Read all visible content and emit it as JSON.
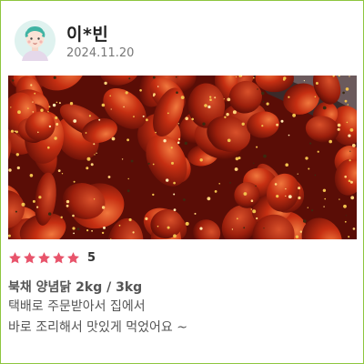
{
  "review": {
    "user_name": "이*빈",
    "date": "2024.11.20",
    "rating_value": "5",
    "stars_filled": 5,
    "stars_total": 5,
    "product": "북채 양념닭 2kg / 3kg",
    "body_lines": [
      "택배로 주문받아서 집에서",
      "바로 조리해서 맛있게 먹었어요 ~"
    ]
  },
  "colors": {
    "border": "#8dc63f",
    "star": "#e8546b",
    "avatar_bg": "#dff2ef",
    "avatar_hair": "#3fb3a3"
  },
  "icons": {
    "avatar": "avatar-icon",
    "star": "star-icon"
  }
}
